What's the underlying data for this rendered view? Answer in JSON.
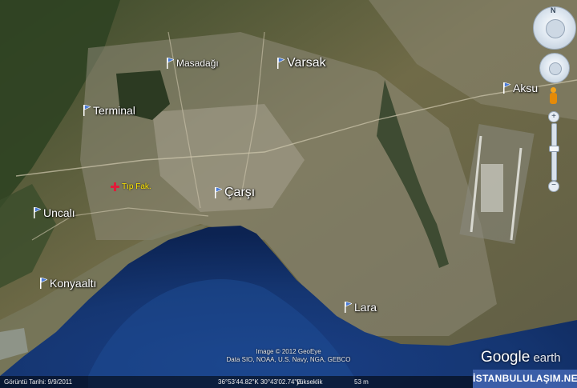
{
  "colors": {
    "sea_deep": "#102a63",
    "sea_mid": "#1f4a8d",
    "sea_shallow": "#4d6f99",
    "land_dark": "#3e4a2c",
    "land_mid": "#6b6a44",
    "urban": "#9a9784",
    "badge": "#3b5ea8"
  },
  "places": [
    {
      "name": "Masadağı",
      "size": "small"
    },
    {
      "name": "Varsak",
      "size": "big"
    },
    {
      "name": "Aksu",
      "size": "med"
    },
    {
      "name": "Terminal",
      "size": "med"
    },
    {
      "name": "Çarşı",
      "size": "big"
    },
    {
      "name": "Uncalı",
      "size": "med"
    },
    {
      "name": "Konyaaltı",
      "size": "med"
    },
    {
      "name": "Lara",
      "size": "med"
    }
  ],
  "hospital": {
    "label": "Tıp Fak."
  },
  "credits": {
    "line1": "Image © 2012 GeoEye",
    "line2": "Data SIO, NOAA, U.S. Navy, NGA, GEBCO"
  },
  "status": {
    "date": "Görüntü Tarihi: 9/9/2011",
    "coords": "36°53'44.82\"K  30°43'02.74\"D",
    "elev_label": "yükseklik",
    "elev": "53 m"
  },
  "logo": {
    "primary": "Google",
    "secondary": " earth"
  },
  "badge": {
    "text": "İSTANBULULAŞIM.NET"
  },
  "nav": {
    "north": "N"
  }
}
